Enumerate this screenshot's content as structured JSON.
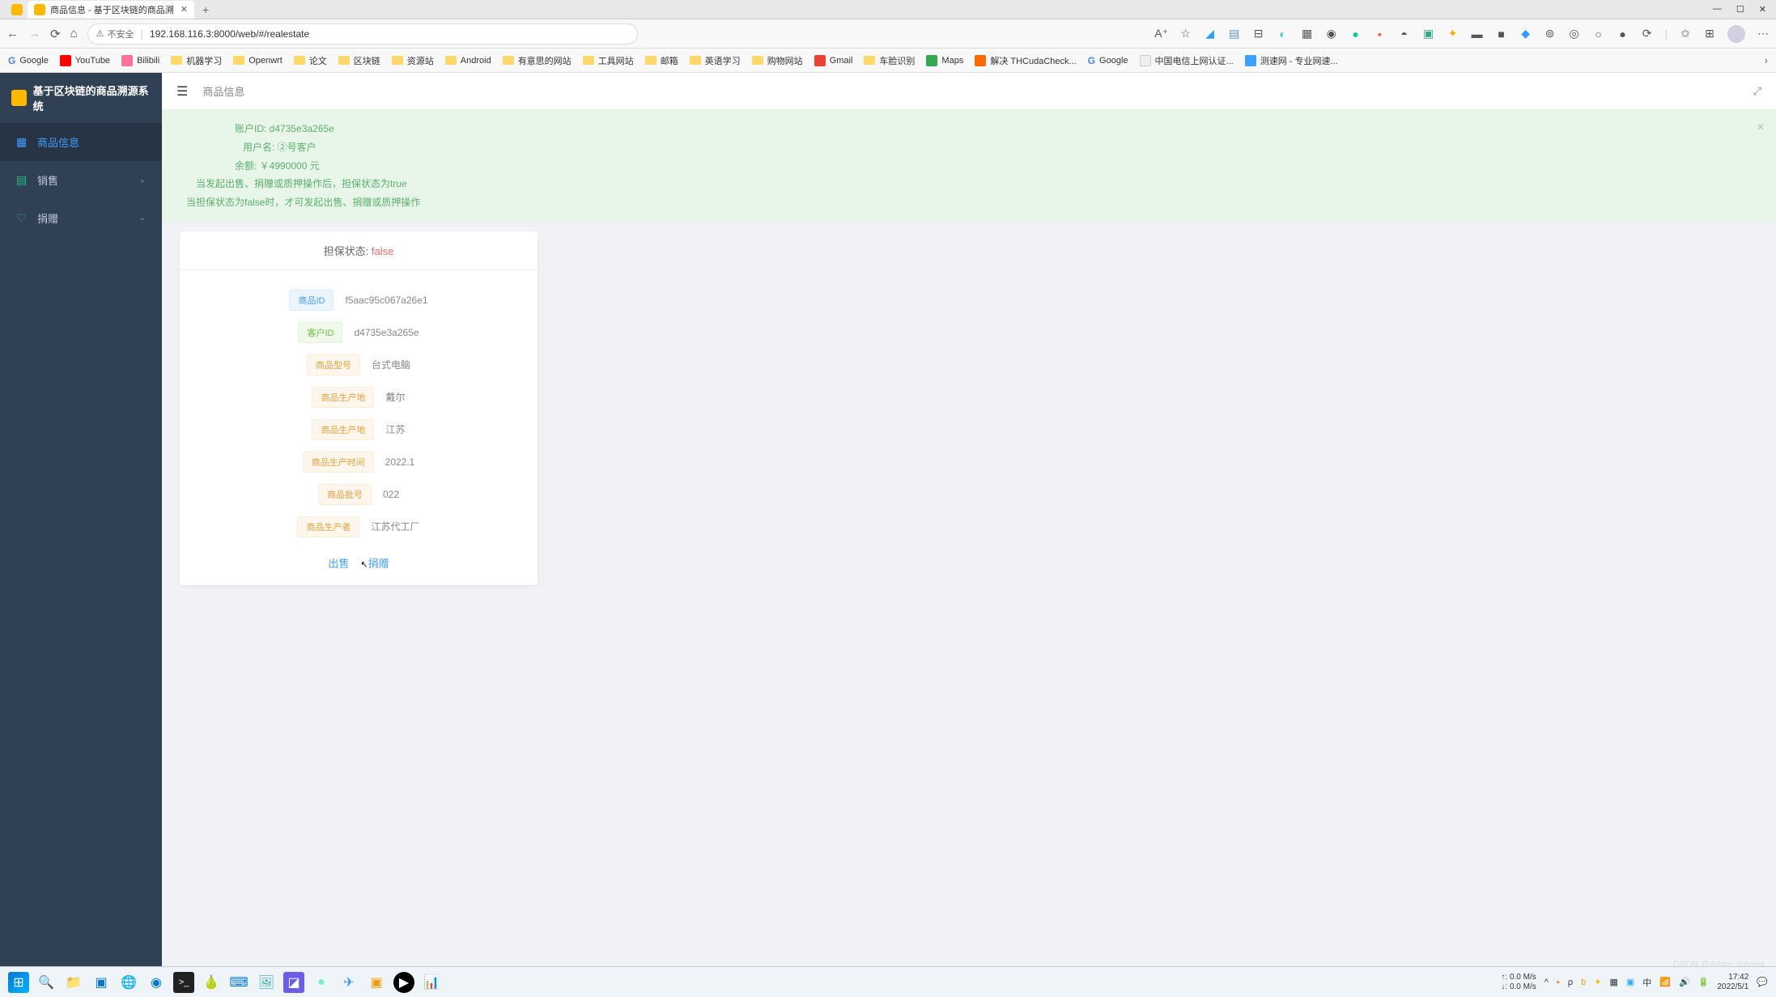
{
  "window": {
    "tab_title": "商品信息 - 基于区块链的商品溯",
    "minimize": "—",
    "maximize": "☐",
    "close": "✕"
  },
  "urlbar": {
    "insecure_label": "不安全",
    "url": "192.168.116.3:8000/web/#/realestate"
  },
  "bookmarks": [
    {
      "label": "Google",
      "type": "google"
    },
    {
      "label": "YouTube",
      "type": "yt"
    },
    {
      "label": "Bilibili",
      "type": "bili"
    },
    {
      "label": "机器学习",
      "type": "folder"
    },
    {
      "label": "Openwrt",
      "type": "folder"
    },
    {
      "label": "论文",
      "type": "folder"
    },
    {
      "label": "区块链",
      "type": "folder"
    },
    {
      "label": "资源站",
      "type": "folder"
    },
    {
      "label": "Android",
      "type": "folder"
    },
    {
      "label": "有意思的网站",
      "type": "folder"
    },
    {
      "label": "工具网站",
      "type": "folder"
    },
    {
      "label": "邮箱",
      "type": "folder"
    },
    {
      "label": "英语学习",
      "type": "folder"
    },
    {
      "label": "购物网站",
      "type": "folder"
    },
    {
      "label": "Gmail",
      "type": "gmail"
    },
    {
      "label": "车脸识别",
      "type": "folder"
    },
    {
      "label": "Maps",
      "type": "maps"
    },
    {
      "label": "解决 THCudaCheck...",
      "type": "tc"
    },
    {
      "label": "Google",
      "type": "google"
    },
    {
      "label": "中国电信上网认证...",
      "type": "page"
    },
    {
      "label": "测速网 - 专业网速...",
      "type": "cs"
    }
  ],
  "app": {
    "title": "基于区块链的商品溯源系统",
    "breadcrumb": "商品信息"
  },
  "sidebar": {
    "items": [
      {
        "label": "商品信息",
        "icon": "▦"
      },
      {
        "label": "销售",
        "icon": "▤"
      },
      {
        "label": "捐赠",
        "icon": "♡"
      }
    ]
  },
  "alert": {
    "line1": "账户ID: d4735e3a265e",
    "line2": "用户名: ②号客户",
    "line3": "余额: ￥4990000 元",
    "line4": "当发起出售、捐赠或质押操作后，担保状态为true",
    "line5": "当担保状态为false时，才可发起出售、捐赠或质押操作"
  },
  "card": {
    "status_label": "担保状态:",
    "status_value": "false",
    "fields": [
      {
        "tag": "商品ID",
        "class": "tag-blue",
        "value": "f5aac95c067a26e1"
      },
      {
        "tag": "客户ID",
        "class": "tag-green",
        "value": "d4735e3a265e"
      },
      {
        "tag": "商品型号",
        "class": "tag-orange",
        "value": "台式电脑"
      },
      {
        "tag": "商品生产地",
        "class": "tag-orange",
        "value": "戴尔"
      },
      {
        "tag": "商品生产地",
        "class": "tag-orange",
        "value": "江苏"
      },
      {
        "tag": "商品生产时间",
        "class": "tag-orange",
        "value": "2022.1"
      },
      {
        "tag": "商品批号",
        "class": "tag-orange",
        "value": "022"
      },
      {
        "tag": "商品生产者",
        "class": "tag-orange",
        "value": "江苏代工厂"
      }
    ],
    "actions": {
      "sell": "出售",
      "donate": "捐赠"
    }
  },
  "taskbar": {
    "net_up": "↑: 0.0 M/s",
    "net_down": "↓: 0.0 M/s",
    "ime": "中",
    "time": "17:42",
    "date": "2022/5/1"
  },
  "watermark": "CSDN @Adam Juhana"
}
